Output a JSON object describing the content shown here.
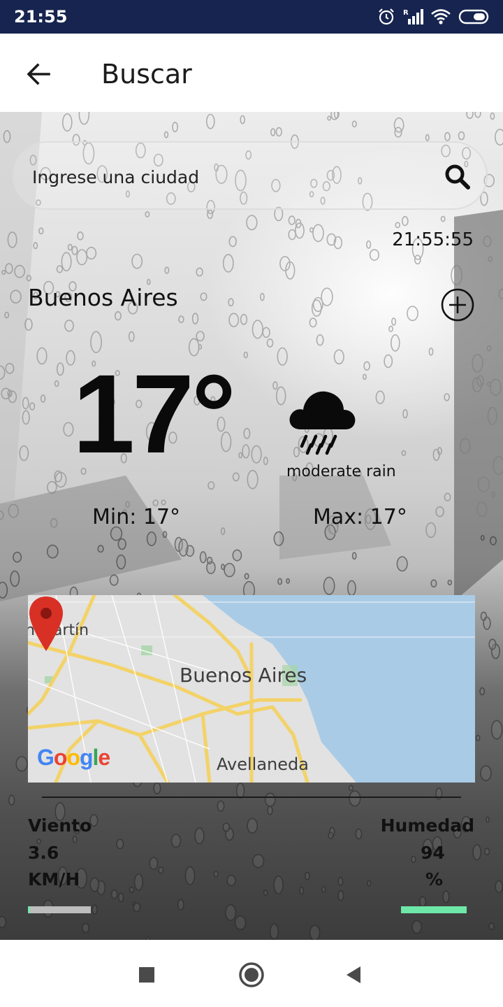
{
  "status_bar": {
    "time": "21:55",
    "icons": [
      "alarm-icon",
      "signal-icon",
      "wifi-icon",
      "battery-icon"
    ]
  },
  "app_bar": {
    "title": "Buscar",
    "back_icon": "arrow-back-icon"
  },
  "search": {
    "placeholder": "Ingrese una ciudad",
    "value": "",
    "icon": "search-icon"
  },
  "clock": "21:55:55",
  "location": {
    "city": "Buenos Aires",
    "add_icon": "add-circle-icon"
  },
  "weather": {
    "temperature": "17°",
    "icon": "rain-cloud-icon",
    "description": "moderate rain",
    "min": "Min: 17°",
    "max": "Max: 17°"
  },
  "map": {
    "labels": {
      "san_martin": "n Martín",
      "city": "Buenos Aires",
      "avellaneda": "Avellaneda"
    },
    "attribution": "Google",
    "marker_icon": "map-pin-icon"
  },
  "stats": {
    "wind": {
      "label": "Viento",
      "value": "3.6",
      "unit": "KM/H",
      "level": 0.03
    },
    "humidity": {
      "label": "Humedad",
      "value": "94",
      "unit": "%",
      "level": 0.94
    }
  },
  "colors": {
    "status_bar": "#16244f",
    "accent_bar": "#6ee8a8",
    "map_water": "#a9cbe6",
    "map_land": "#e2e2e2",
    "map_road": "#f3d268",
    "pin": "#d93025"
  },
  "nav_bar": {
    "buttons": [
      "recent-apps-icon",
      "home-icon",
      "back-icon"
    ]
  }
}
